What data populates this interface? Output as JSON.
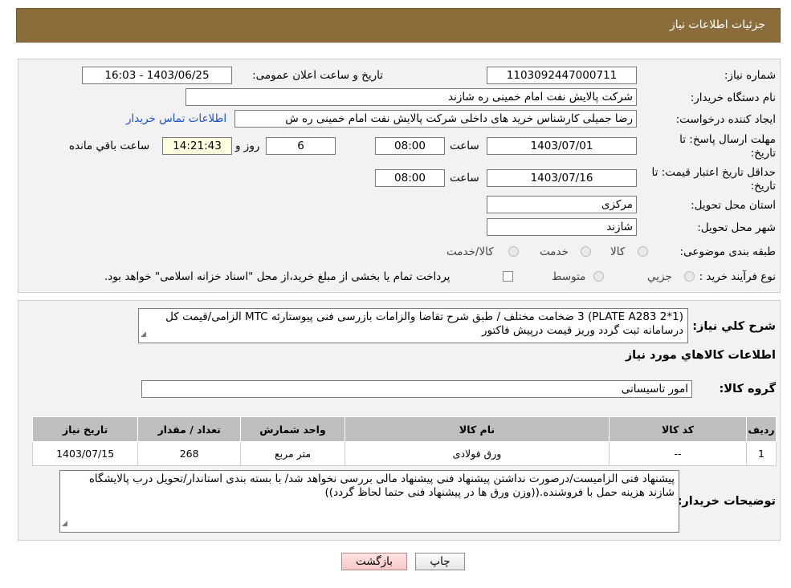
{
  "header": {
    "title": "جزئیات اطلاعات نیاز"
  },
  "form": {
    "need_number_label": "شماره نیاز:",
    "need_number": "1103092447000711",
    "announce_label": "تاریخ و ساعت اعلان عمومی:",
    "announce_value": "1403/06/25 - 16:03",
    "buyer_org_label": "نام دستگاه خریدار:",
    "buyer_org": "شرکت پالایش نفت امام خمینی  ره  شازند",
    "creator_label": "ایجاد کننده درخواست:",
    "creator": "رضا جمیلی کارشناس خرید های داخلی  شرکت پالایش نفت امام خمینی  ره  ش",
    "contact_link": "اطلاعات تماس خریدار",
    "deadline_label_1": "مهلت ارسال پاسخ: تا",
    "deadline_label_2": "تاریخ:",
    "deadline_date": "1403/07/01",
    "time_label": "ساعت",
    "deadline_time": "08:00",
    "days_value": "6",
    "days_label": "روز و",
    "remaining_time": "14:21:43",
    "remaining_label": "ساعت باقي مانده",
    "validity_label_1": "حداقل تاریخ اعتبار قیمت: تا",
    "validity_label_2": "تاریخ:",
    "validity_date": "1403/07/16",
    "validity_time_label": "ساعت",
    "validity_time": "08:00",
    "province_label": "استان محل تحویل:",
    "province": "مرکزی",
    "city_label": "شهر محل تحویل:",
    "city": "شازند",
    "category_label": "طبقه بندی موضوعی:",
    "category_options": [
      "کالا",
      "خدمت",
      "کالا/خدمت"
    ],
    "process_label": "نوع فرآیند خرید :",
    "process_options": [
      "جزيي",
      "متوسط"
    ],
    "payment_note": "پرداخت تمام یا بخشی از مبلغ خرید،از محل \"اسناد خزانه اسلامی\" خواهد بود."
  },
  "details": {
    "description_label": "شرح كلي نياز:",
    "description": "(1*PLATE A283 2) 3 ضخامت مختلف / طبق شرح تقاضا والزامات بازرسی فنی پیوستارئه MTC الزامی/قیمت کل درسامانه ثبت گردد وریز قیمت درپیش فاکتور",
    "goods_info_title": "اطلاعات كالاهاي مورد نياز",
    "goods_group_label": "گروه كالا:",
    "goods_group": "امور تاسیساتی",
    "table": {
      "headers": [
        "رديف",
        "کد کالا",
        "نام کالا",
        "واحد شمارش",
        "تعداد / مقدار",
        "تاریخ نیاز"
      ],
      "rows": [
        [
          "1",
          "--",
          "ورق فولادی",
          "متر مربع",
          "268",
          "1403/07/15"
        ]
      ]
    },
    "buyer_notes_label": "توضیحات خریدار:",
    "buyer_notes": "پیشنهاد فنی الزامیست/درصورت نداشتن پیشنهاد فنی پیشنهاد مالی بررسی نخواهد شد/ با بسته بندی استاندار/تحویل درب پالایشگاه شازند هزینه حمل با فروشنده.((وزن ورق ها در پیشنهاد فنی حتما لحاظ گردد))"
  },
  "buttons": {
    "print": "چاپ",
    "back": "بازگشت"
  },
  "colors": {
    "header_bg": "#8a6d3b",
    "link": "#1a4fd8",
    "table_header": "#bfbfbf"
  }
}
